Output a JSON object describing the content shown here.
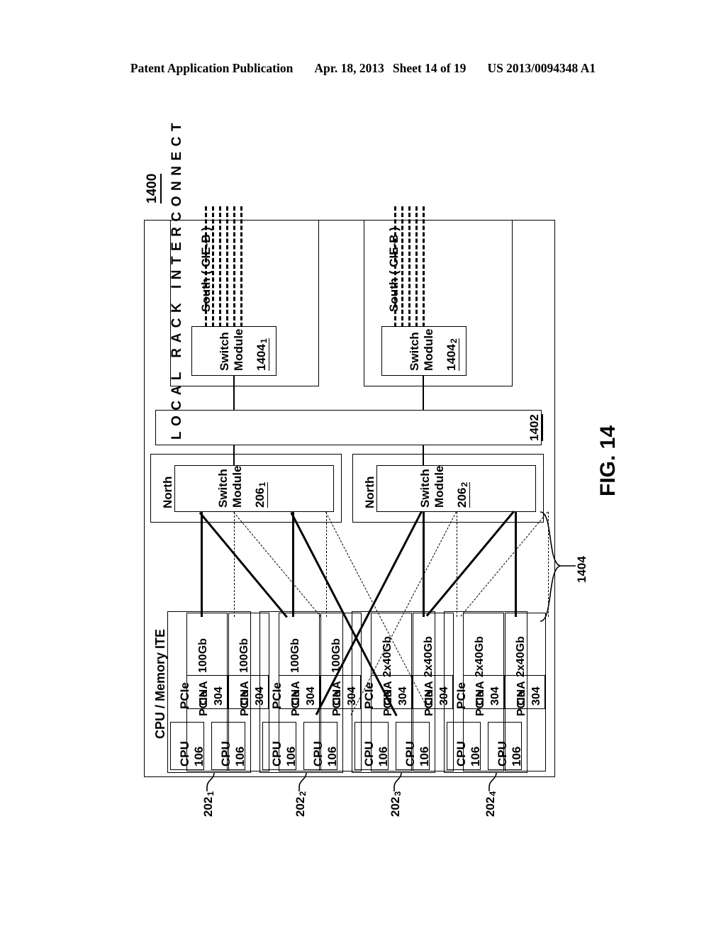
{
  "header": {
    "publication": "Patent Application Publication",
    "date": "Apr. 18, 2013",
    "sheet": "Sheet 14 of 19",
    "patent_number": "US 2013/0094348 A1"
  },
  "figure": {
    "label": "FIG. 14",
    "system_ref": "1400",
    "interconnect": {
      "text": "LOCAL RACK INTERCONNECT",
      "ref": "1402"
    },
    "link_group_ref": "1404",
    "ite_section_label": "CPU / Memory ITE",
    "south_switches": [
      {
        "direction": "South  ( CIE-B )",
        "title_line1": "Switch",
        "title_line2": "Module",
        "ref": "1404",
        "ref_sub": "1"
      },
      {
        "direction": "South  ( CIE-B )",
        "title_line1": "Switch",
        "title_line2": "Module",
        "ref": "1404",
        "ref_sub": "2"
      }
    ],
    "north_switches": [
      {
        "direction": "North",
        "title_line1": "Switch",
        "title_line2": "Module",
        "ref": "206",
        "ref_sub": "1"
      },
      {
        "direction": "North",
        "title_line1": "Switch",
        "title_line2": "Module",
        "ref": "206",
        "ref_sub": "2"
      }
    ],
    "ite_groups": [
      {
        "ref": "202",
        "ref_sub": "1",
        "bus_label": "PCIe",
        "nodes": [
          {
            "cpu_label": "CPU",
            "cpu_ref": "106",
            "pcie_label": "PCIe",
            "cna_label": "CNA",
            "cna_ref": "304",
            "port_rate": "100Gb"
          },
          {
            "cpu_label": "CPU",
            "cpu_ref": "106",
            "pcie_label": "PCIe",
            "cna_label": "CNA",
            "cna_ref": "304",
            "port_rate": "100Gb"
          }
        ]
      },
      {
        "ref": "202",
        "ref_sub": "2",
        "bus_label": "PCIe",
        "nodes": [
          {
            "cpu_label": "CPU",
            "cpu_ref": "106",
            "pcie_label": "PCIe",
            "cna_label": "CNA",
            "cna_ref": "304",
            "port_rate": "100Gb"
          },
          {
            "cpu_label": "CPU",
            "cpu_ref": "106",
            "pcie_label": "PCIe",
            "cna_label": "CNA",
            "cna_ref": "304",
            "port_rate": "100Gb"
          }
        ]
      },
      {
        "ref": "202",
        "ref_sub": "3",
        "bus_label": "PCIe",
        "nodes": [
          {
            "cpu_label": "CPU",
            "cpu_ref": "106",
            "pcie_label": "PCIe",
            "cna_label": "CNA",
            "cna_ref": "304",
            "port_rate": "2x40Gb"
          },
          {
            "cpu_label": "CPU",
            "cpu_ref": "106",
            "pcie_label": "PCIe",
            "cna_label": "CNA",
            "cna_ref": "304",
            "port_rate": "2x40Gb"
          }
        ]
      },
      {
        "ref": "202",
        "ref_sub": "4",
        "bus_label": "PCIe",
        "nodes": [
          {
            "cpu_label": "CPU",
            "cpu_ref": "106",
            "pcie_label": "PCIe",
            "cna_label": "CNA",
            "cna_ref": "304",
            "port_rate": "2x40Gb"
          },
          {
            "cpu_label": "CPU",
            "cpu_ref": "106",
            "pcie_label": "PCIe",
            "cna_label": "CNA",
            "cna_ref": "304",
            "port_rate": "2x40Gb"
          }
        ]
      }
    ]
  }
}
